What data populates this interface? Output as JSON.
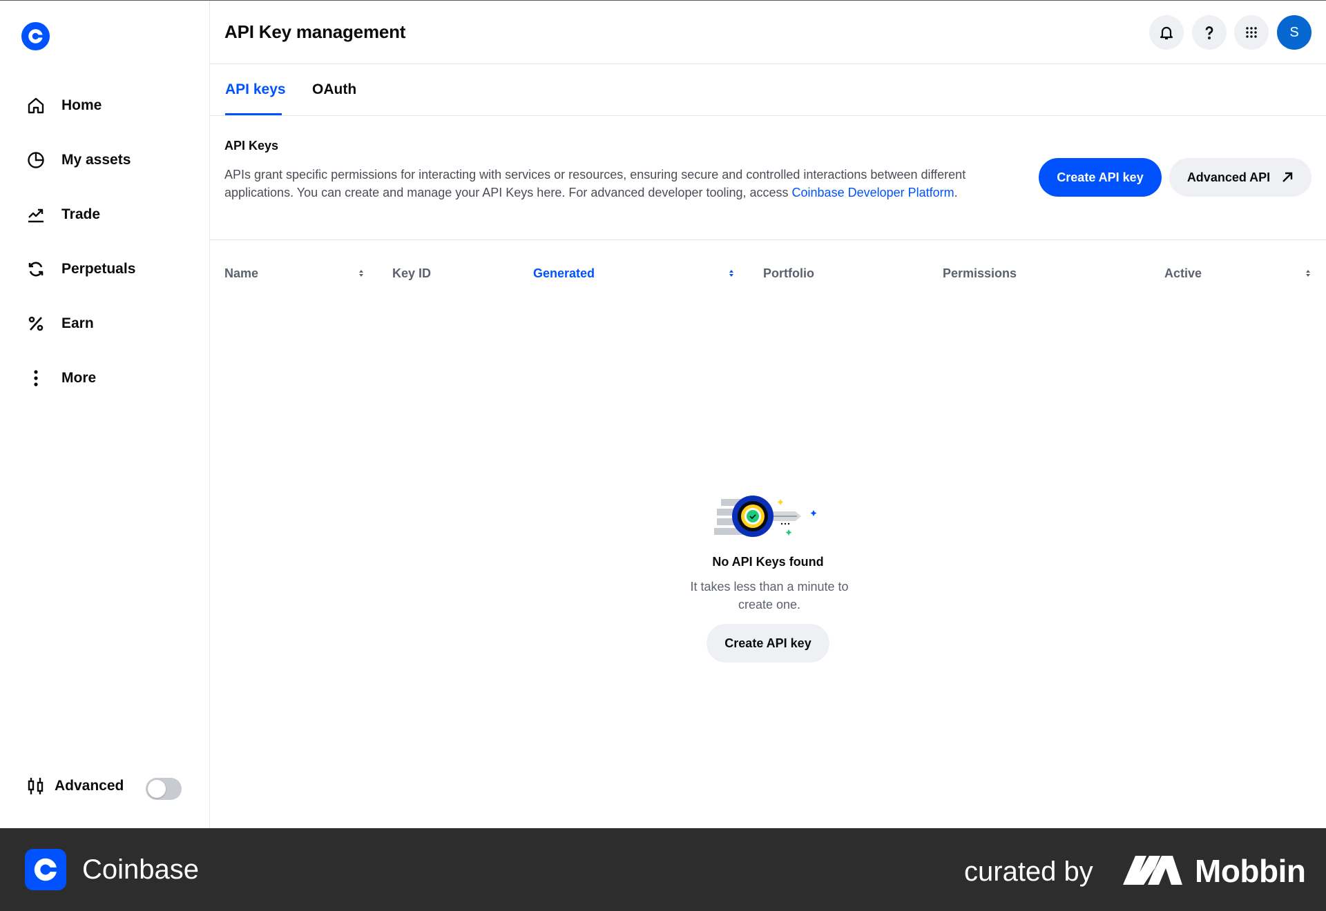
{
  "sidebar": {
    "items": [
      {
        "label": "Home",
        "icon": "home-icon"
      },
      {
        "label": "My assets",
        "icon": "pie-chart-icon"
      },
      {
        "label": "Trade",
        "icon": "trend-up-icon"
      },
      {
        "label": "Perpetuals",
        "icon": "refresh-icon"
      },
      {
        "label": "Earn",
        "icon": "percent-icon"
      },
      {
        "label": "More",
        "icon": "more-vertical-icon"
      }
    ],
    "advanced": {
      "label": "Advanced",
      "enabled": false
    }
  },
  "header": {
    "title": "API Key management",
    "avatar_initial": "S"
  },
  "tabs": [
    {
      "label": "API keys",
      "active": true
    },
    {
      "label": "OAuth",
      "active": false
    }
  ],
  "section": {
    "title": "API Keys",
    "description": "APIs grant specific permissions for interacting with services or resources, ensuring secure and controlled interactions between different applications. You can create and manage your API Keys here. For advanced developer tooling, access ",
    "link_text": "Coinbase Developer Platform",
    "description_end": ".",
    "create_button": "Create API key",
    "advanced_button": "Advanced API"
  },
  "table": {
    "columns": [
      "Name",
      "Key ID",
      "Generated",
      "Portfolio",
      "Permissions",
      "Active"
    ],
    "sorted_column": "Generated"
  },
  "empty_state": {
    "title": "No API Keys found",
    "subtitle": "It takes less than a minute to create one.",
    "button": "Create API key"
  },
  "footer": {
    "brand": "Coinbase",
    "curated_by": "curated by",
    "curator": "Mobbin"
  },
  "colors": {
    "accent": "#0052ff",
    "avatar": "#0667d0",
    "footer_bg": "#2d2d2d"
  }
}
